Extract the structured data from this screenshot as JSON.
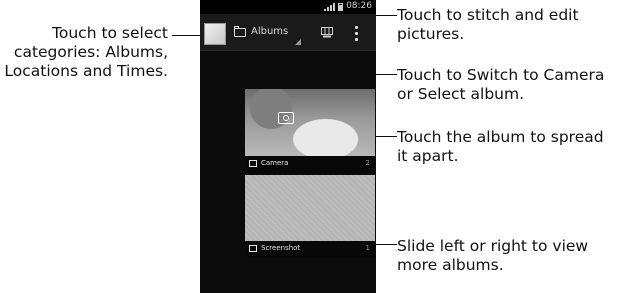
{
  "callouts": {
    "left": "Touch to select categories: Albums, Locations and Times.",
    "stitch": "Touch to stitch and edit pictures.",
    "switch": "Touch to  Switch to Camera or Select album.",
    "spread": "Touch the album to spread it apart.",
    "slide": "Slide left or right to view more albums."
  },
  "phone": {
    "status_time": "08:26",
    "action_bar": {
      "title": "Albums"
    },
    "albums": [
      {
        "name": "Camera",
        "count": "2",
        "icon": "camera-icon"
      },
      {
        "name": "Screenshot",
        "count": "1",
        "icon": "folder-icon"
      }
    ]
  }
}
